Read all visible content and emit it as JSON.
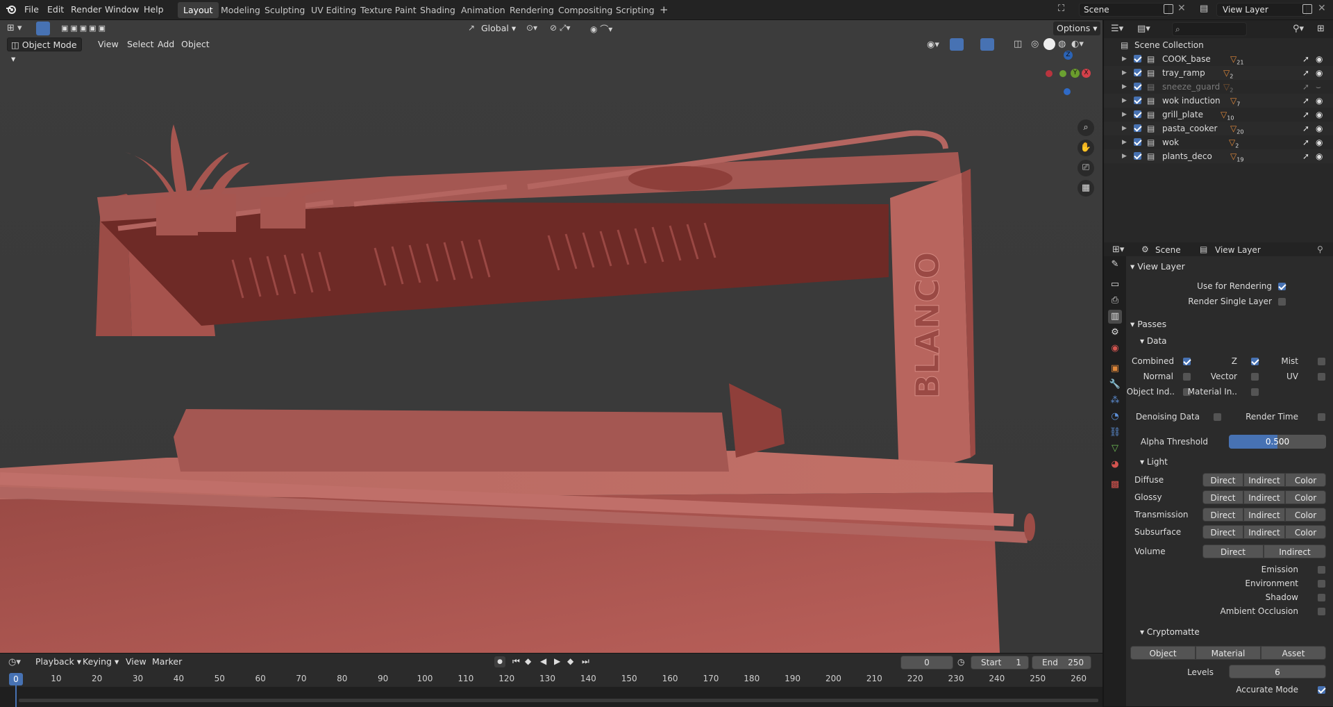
{
  "menubar": {
    "items": [
      "File",
      "Edit",
      "Render",
      "Window",
      "Help"
    ]
  },
  "workspaces": [
    "Layout",
    "Modeling",
    "Sculpting",
    "UV Editing",
    "Texture Paint",
    "Shading",
    "Animation",
    "Rendering",
    "Compositing",
    "Scripting"
  ],
  "workspace_add": "+",
  "scene": {
    "label": "Scene"
  },
  "view_layer": {
    "label": "View Layer"
  },
  "viewport": {
    "orientation": "Global",
    "options": "Options",
    "mode": "Object Mode",
    "menus": [
      "View",
      "Select",
      "Add",
      "Object"
    ],
    "gizmo": {
      "z": "Z",
      "x": "X",
      "y": "Y"
    },
    "model_label": "BLANCO",
    "model_color": "#b0615a"
  },
  "outliner": {
    "search_placeholder": "",
    "root": "Scene Collection",
    "items": [
      {
        "name": "COOK_base",
        "count": "21",
        "visible": true
      },
      {
        "name": "tray_ramp",
        "count": "2",
        "visible": true
      },
      {
        "name": "sneeze_guard",
        "count": "2",
        "visible": false
      },
      {
        "name": "wok induction",
        "count": "7",
        "visible": true
      },
      {
        "name": "grill_plate",
        "count": "10",
        "visible": true
      },
      {
        "name": "pasta_cooker",
        "count": "20",
        "visible": true
      },
      {
        "name": "wok",
        "count": "2",
        "visible": true
      },
      {
        "name": "plants_deco",
        "count": "19",
        "visible": true
      }
    ]
  },
  "properties": {
    "breadcrumb_scene": "Scene",
    "breadcrumb_layer": "View Layer",
    "panel_view_layer": "View Layer",
    "use_for_rendering": "Use for Rendering",
    "render_single_layer": "Render Single Layer",
    "passes": "Passes",
    "data": "Data",
    "combined": "Combined",
    "z": "Z",
    "mist": "Mist",
    "normal": "Normal",
    "vector": "Vector",
    "uv": "UV",
    "object_ind": "Object Ind..",
    "material_ind": "Material In..",
    "denoising": "Denoising Data",
    "render_time": "Render Time",
    "alpha_threshold": "Alpha Threshold",
    "alpha_value": "0.500",
    "alpha_fraction": 0.5,
    "light": "Light",
    "light_rows": [
      {
        "label": "Diffuse",
        "b1": "Direct",
        "b2": "Indirect",
        "b3": "Color"
      },
      {
        "label": "Glossy",
        "b1": "Direct",
        "b2": "Indirect",
        "b3": "Color"
      },
      {
        "label": "Transmission",
        "b1": "Direct",
        "b2": "Indirect",
        "b3": "Color"
      },
      {
        "label": "Subsurface",
        "b1": "Direct",
        "b2": "Indirect",
        "b3": "Color"
      }
    ],
    "volume": "Volume",
    "vol_direct": "Direct",
    "vol_indirect": "Indirect",
    "emission": "Emission",
    "environment": "Environment",
    "shadow": "Shadow",
    "ambient_occlusion": "Ambient Occlusion",
    "cryptomatte": "Cryptomatte",
    "crypto_object": "Object",
    "crypto_material": "Material",
    "crypto_asset": "Asset",
    "levels": "Levels",
    "levels_value": "6",
    "accurate_mode": "Accurate Mode"
  },
  "timeline": {
    "menus": [
      "Playback",
      "Keying",
      "View",
      "Marker"
    ],
    "current_frame": "0",
    "start_label": "Start",
    "start": "1",
    "end_label": "End",
    "end": "250",
    "ticks": [
      "0",
      "10",
      "20",
      "30",
      "40",
      "50",
      "60",
      "70",
      "80",
      "90",
      "100",
      "110",
      "120",
      "130",
      "140",
      "150",
      "160",
      "170",
      "180",
      "190",
      "200",
      "210",
      "220",
      "230",
      "240",
      "250",
      "260"
    ]
  },
  "colors": {
    "accent": "#4772b3",
    "active_frame": "#4772b3",
    "orange": "#e0883a"
  }
}
